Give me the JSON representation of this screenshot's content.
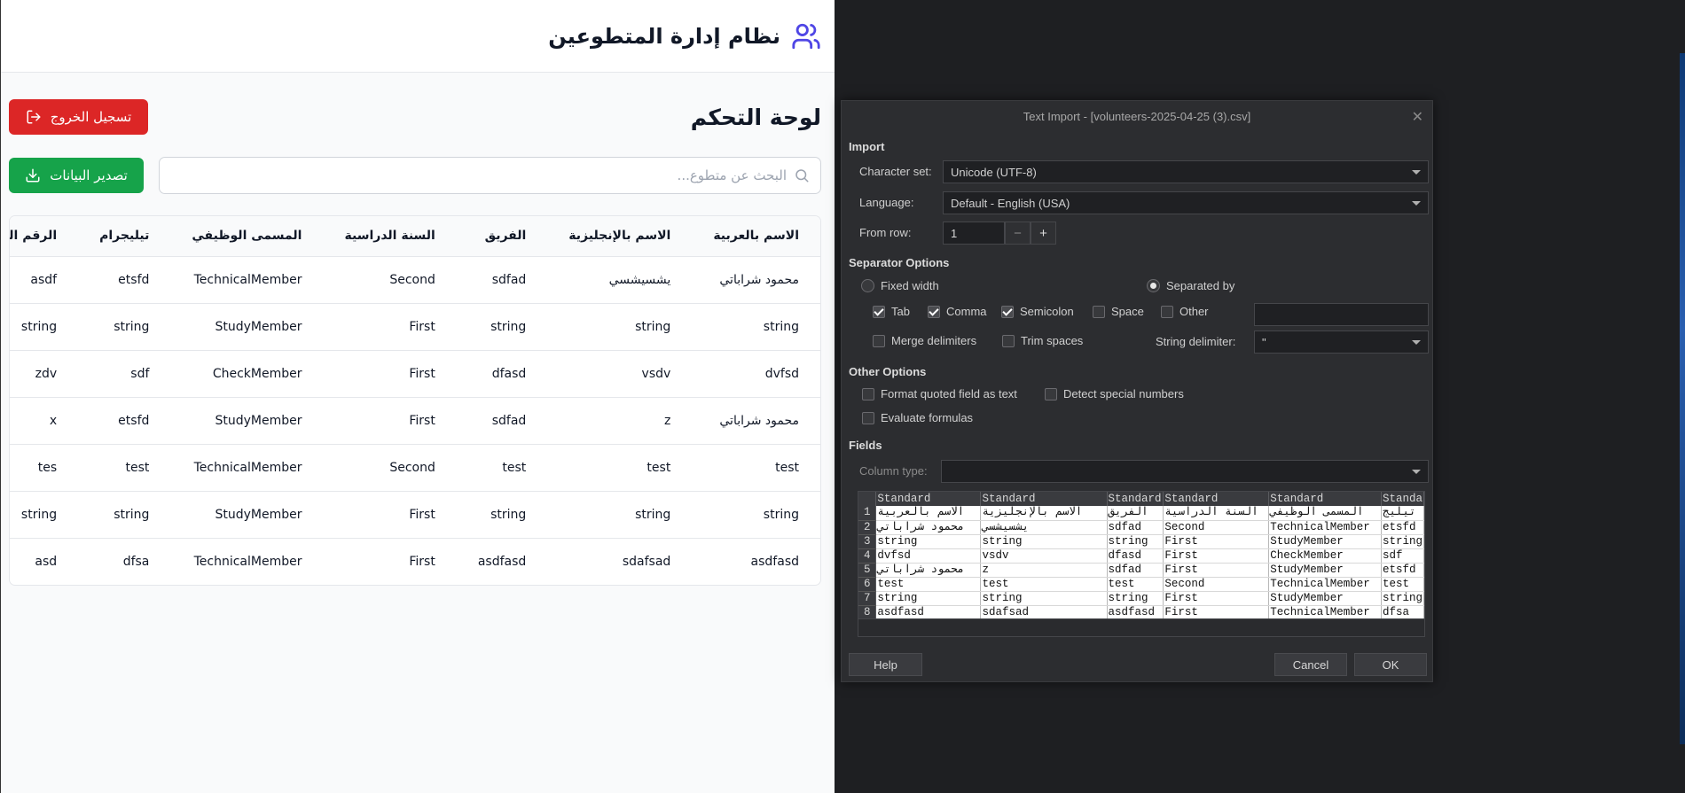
{
  "app": {
    "title": "نظام إدارة المتطوعين",
    "icon": "users-icon"
  },
  "dashboard": {
    "title": "لوحة التحكم",
    "logout_label": "تسجيل الخروج",
    "export_label": "تصدير البيانات",
    "search_placeholder": "البحث عن متطوع...",
    "colors": {
      "primary": "#4f46e5",
      "danger": "#dc2626",
      "success": "#16a34a"
    }
  },
  "table": {
    "headers": [
      "الاسم بالعربية",
      "الاسم بالإنجليزية",
      "الفريق",
      "السنة الدراسية",
      "المسمى الوظيفي",
      "تيليجرام",
      "الرقم الجامعي"
    ],
    "rows": [
      [
        "محمود شراباتي",
        "يشسيشسي",
        "sdfad",
        "Second",
        "TechnicalMember",
        "etsfd",
        "asdf"
      ],
      [
        "string",
        "string",
        "string",
        "First",
        "StudyMember",
        "string",
        "string"
      ],
      [
        "dvfsd",
        "vsdv",
        "dfasd",
        "First",
        "CheckMember",
        "sdf",
        "zdv"
      ],
      [
        "محمود شراباتي",
        "z",
        "sdfad",
        "First",
        "StudyMember",
        "etsfd",
        "x"
      ],
      [
        "test",
        "test",
        "test",
        "Second",
        "TechnicalMember",
        "test",
        "tes"
      ],
      [
        "string",
        "string",
        "string",
        "First",
        "StudyMember",
        "string",
        "string"
      ],
      [
        "asdfasd",
        "sdafsad",
        "asdfasd",
        "First",
        "TechnicalMember",
        "dfsa",
        "asd"
      ]
    ]
  },
  "dialog": {
    "title": "Text Import - [volunteers-2025-04-25 (3).csv]",
    "import_section": "Import",
    "charset_label": "Character set:",
    "charset_value": "Unicode (UTF-8)",
    "language_label": "Language:",
    "language_value": "Default - English (USA)",
    "from_row_label": "From row:",
    "from_row_value": "1",
    "separator_section": "Separator Options",
    "fixed_width": "Fixed width",
    "separated_by": "Separated by",
    "tab": "Tab",
    "comma": "Comma",
    "semicolon": "Semicolon",
    "space": "Space",
    "other": "Other",
    "merge_delimiters": "Merge delimiters",
    "trim_spaces": "Trim spaces",
    "string_delimiter_label": "String delimiter:",
    "string_delimiter_value": "\"",
    "other_section": "Other Options",
    "format_quoted": "Format quoted field as text",
    "detect_special": "Detect special numbers",
    "evaluate_formulas": "Evaluate formulas",
    "fields_section": "Fields",
    "column_type_label": "Column type:",
    "help": "Help",
    "cancel": "Cancel",
    "ok": "OK",
    "preview": {
      "col_headers": [
        "Standard",
        "Standard",
        "Standard",
        "Standard",
        "Standard",
        "Standa"
      ],
      "rows": [
        [
          "1",
          "الاسم بالعربية",
          "الاسم بالإنجليزية",
          "الفريق",
          "السنة الدراسية",
          "المسمى الوظيفي",
          "تيليج"
        ],
        [
          "2",
          "محمود شراباتي",
          "يشسيشسي",
          "sdfad",
          "Second",
          "TechnicalMember",
          "etsfd"
        ],
        [
          "3",
          "string",
          "string",
          "string",
          "First",
          "StudyMember",
          "string"
        ],
        [
          "4",
          "dvfsd",
          "vsdv",
          "dfasd",
          "First",
          "CheckMember",
          "sdf"
        ],
        [
          "5",
          "محمود شراباتي",
          "z",
          "sdfad",
          "First",
          "StudyMember",
          "etsfd"
        ],
        [
          "6",
          "test",
          "test",
          "test",
          "Second",
          "TechnicalMember",
          "test"
        ],
        [
          "7",
          "string",
          "string",
          "string",
          "First",
          "StudyMember",
          "string"
        ],
        [
          "8",
          "asdfasd",
          "sdafsad",
          "asdfasd",
          "First",
          "TechnicalMember",
          "dfsa"
        ]
      ]
    }
  }
}
